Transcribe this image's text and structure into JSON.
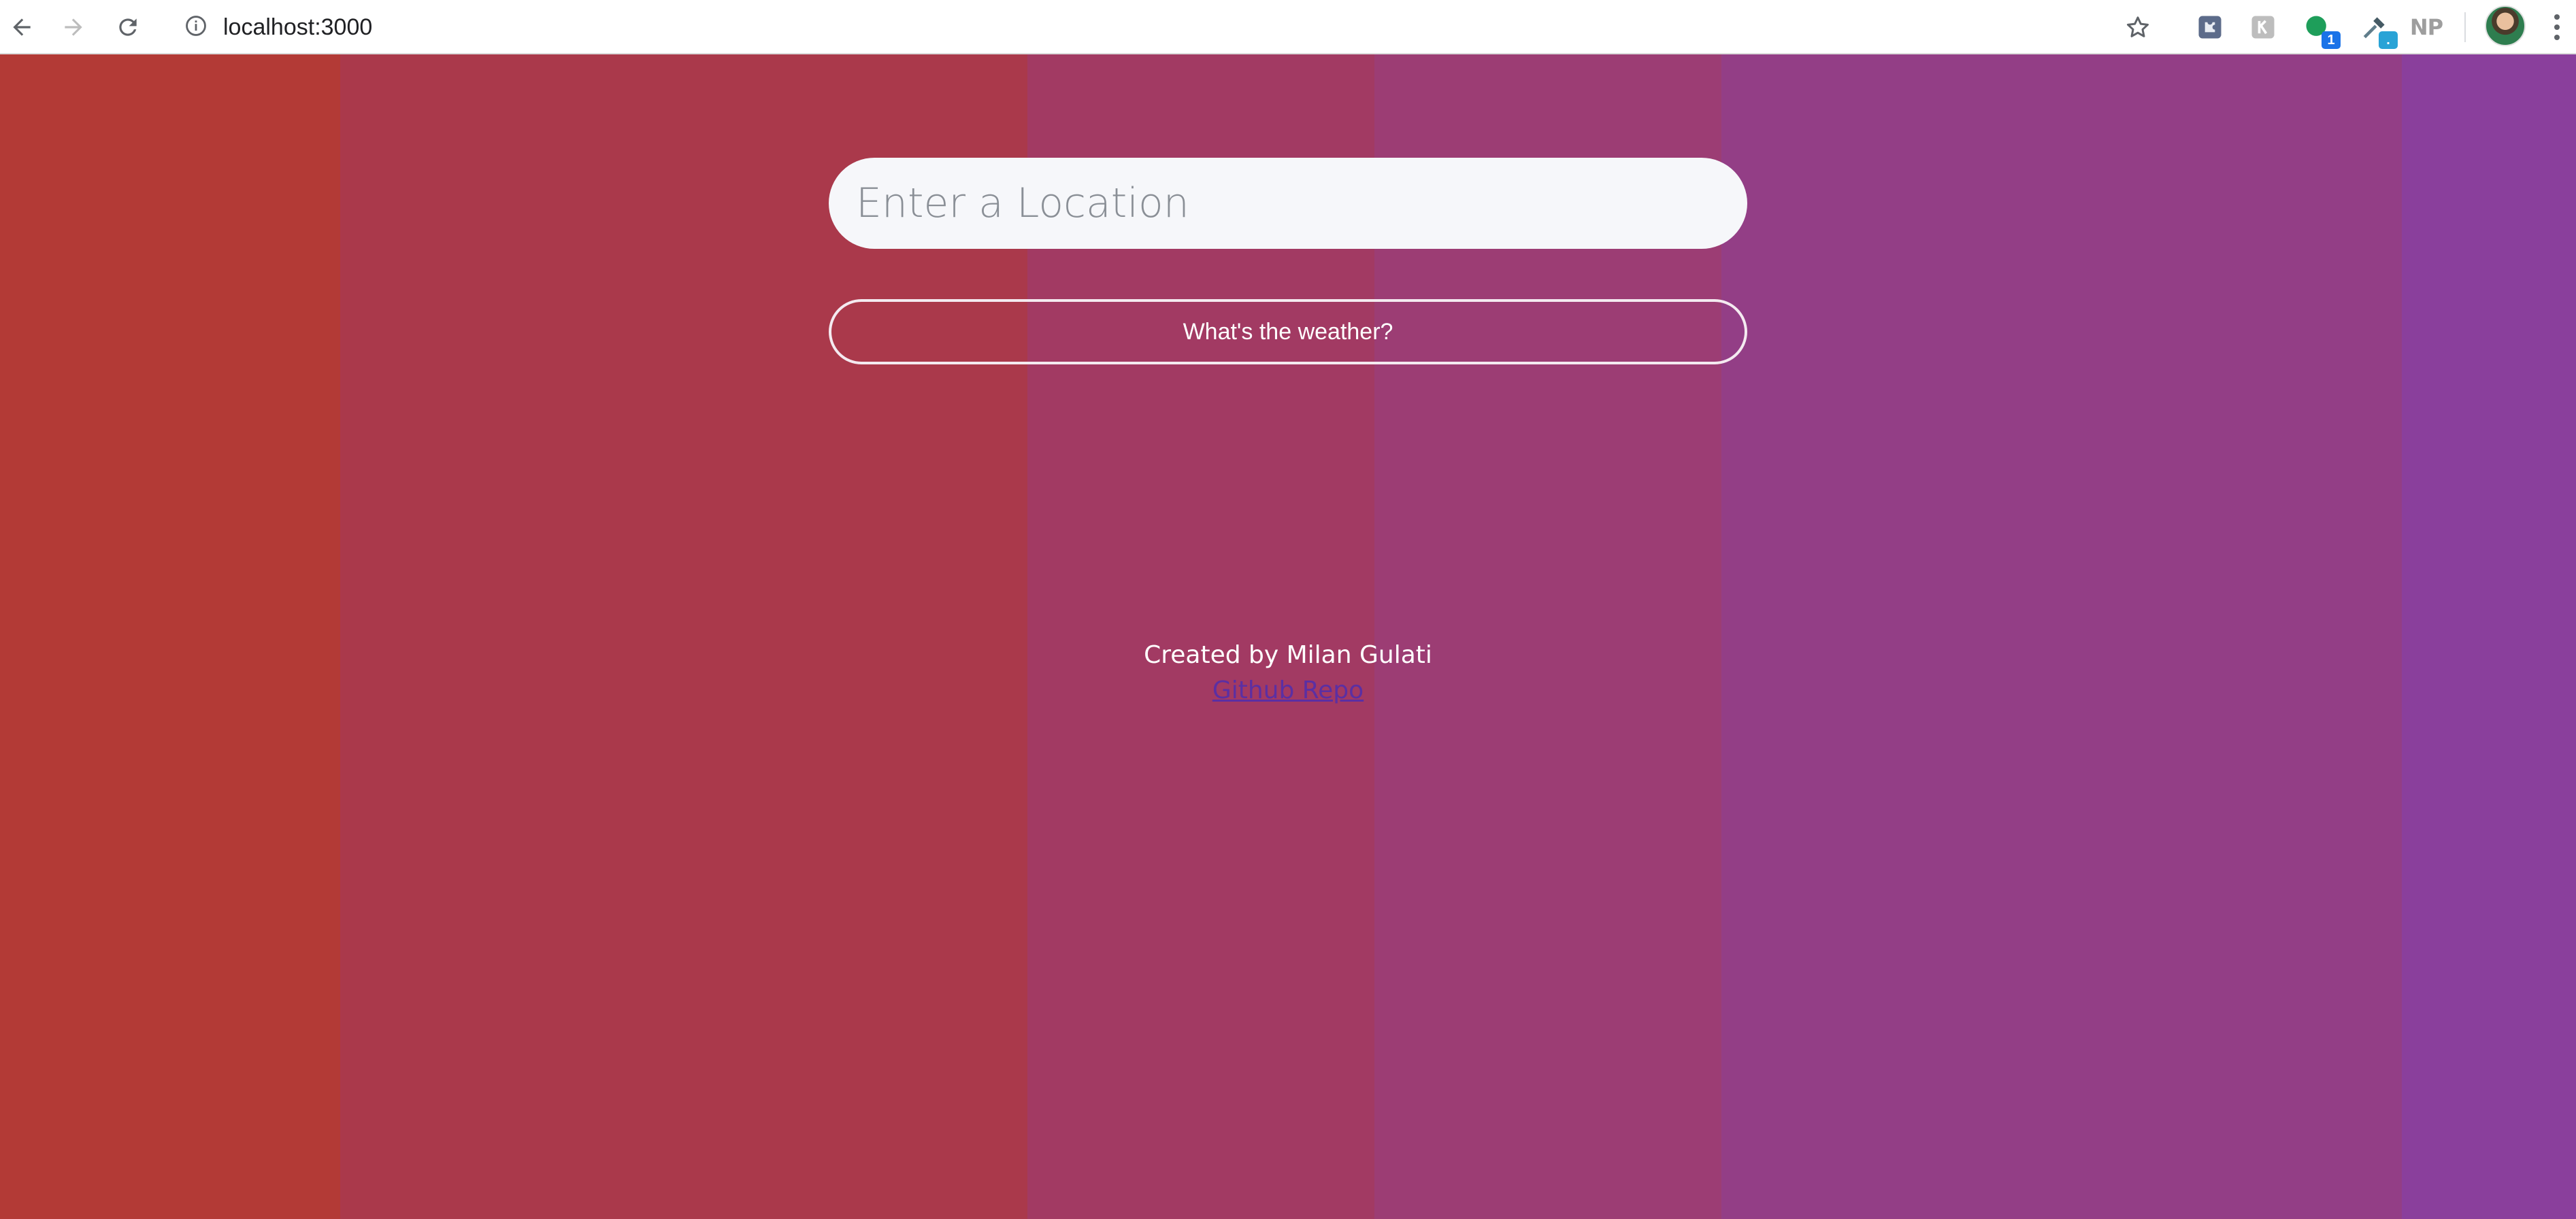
{
  "browser": {
    "url": "localhost:3000",
    "extensions": [
      {
        "icon": "puzzle-extension-icon",
        "badge": ""
      },
      {
        "icon": "k-extension-icon",
        "badge": ""
      },
      {
        "icon": "green-dot-extension-icon",
        "badge": "1"
      },
      {
        "icon": "eyedropper-extension-icon",
        "badge": "."
      },
      {
        "icon": "np-extension-icon",
        "label": "NP"
      }
    ],
    "avatar_icon": "profile-avatar"
  },
  "page": {
    "search": {
      "placeholder": "Enter a Location",
      "value": ""
    },
    "weather_button_label": "What's the weather?",
    "footer": {
      "credit": "Created by Milan Gulati",
      "repo_link": "Github Repo"
    }
  },
  "colors": {
    "gradient_left": "#b33a36",
    "gradient_right": "#8a3f99",
    "input_background": "#f6f7fa",
    "link": "#5b2fa3"
  }
}
